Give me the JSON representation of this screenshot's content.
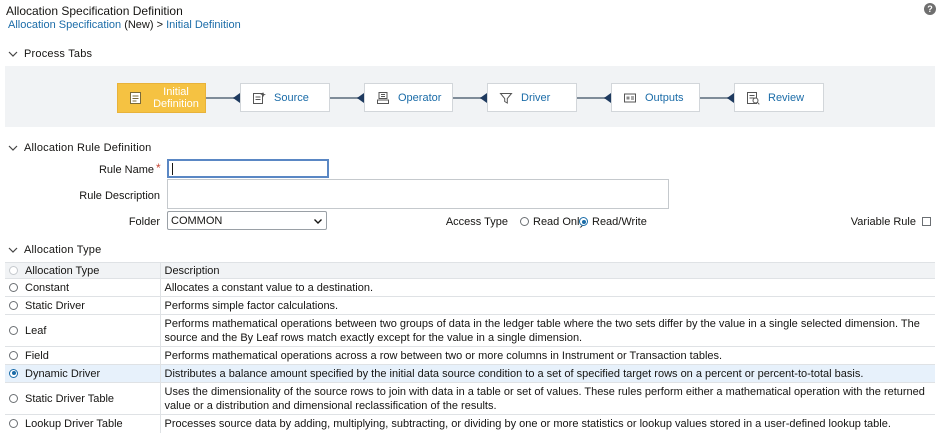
{
  "page": {
    "title": "Allocation Specification Definition",
    "breadcrumb": {
      "root": "Allocation Specification",
      "state": "(New)",
      "sep": ">",
      "current": "Initial Definition"
    }
  },
  "process_tabs": {
    "header": "Process Tabs",
    "steps": [
      {
        "label": "Initial Definition",
        "icon": "document-edit-icon",
        "active": true
      },
      {
        "label": "Source",
        "icon": "source-icon",
        "active": false
      },
      {
        "label": "Operator",
        "icon": "operator-icon",
        "active": false
      },
      {
        "label": "Driver",
        "icon": "filter-icon",
        "active": false
      },
      {
        "label": "Outputs",
        "icon": "outputs-icon",
        "active": false
      },
      {
        "label": "Review",
        "icon": "review-icon",
        "active": false
      }
    ]
  },
  "rule_definition": {
    "header": "Allocation Rule Definition",
    "rule_name_label": "Rule Name",
    "rule_name_value": "",
    "rule_description_label": "Rule Description",
    "rule_description_value": "",
    "folder_label": "Folder",
    "folder_value": "COMMON",
    "access_type_label": "Access Type",
    "access_options": [
      {
        "label": "Read Only",
        "selected": false
      },
      {
        "label": "Read/Write",
        "selected": true
      }
    ],
    "variable_rule_label": "Variable Rule",
    "variable_rule_checked": false
  },
  "allocation_type": {
    "header": "Allocation Type",
    "columns": [
      "Allocation Type",
      "Description"
    ],
    "rows": [
      {
        "type": "Constant",
        "description": "Allocates a constant value to a destination.",
        "selected": false
      },
      {
        "type": "Static Driver",
        "description": "Performs simple factor calculations.",
        "selected": false
      },
      {
        "type": "Leaf",
        "description": "Performs mathematical operations between two groups of data in the ledger table where the two sets differ by the value in a single selected dimension. The source and the By Leaf rows match exactly except for the value in a single dimension.",
        "selected": false
      },
      {
        "type": "Field",
        "description": "Performs mathematical operations across a row between two or more columns in Instrument or Transaction tables.",
        "selected": false
      },
      {
        "type": "Dynamic Driver",
        "description": "Distributes a balance amount specified by the initial data source condition to a set of specified target rows on a percent or percent-to-total basis.",
        "selected": true
      },
      {
        "type": "Static Driver Table",
        "description": "Uses the dimensionality of the source rows to join with data in a table or set of values. These rules perform either a mathematical operation with the returned value or a distribution and dimensional reclassification of the results.",
        "selected": false
      },
      {
        "type": "Lookup Driver Table",
        "description": "Processes source data by adding, multiplying, subtracting, or dividing by one or more statistics or lookup values stored in a user-defined lookup table.",
        "selected": false
      }
    ]
  },
  "colors": {
    "link": "#1b6ca8",
    "active_step": "#f5c242",
    "selected_row": "#e7f1fb",
    "required": "#c74634"
  }
}
